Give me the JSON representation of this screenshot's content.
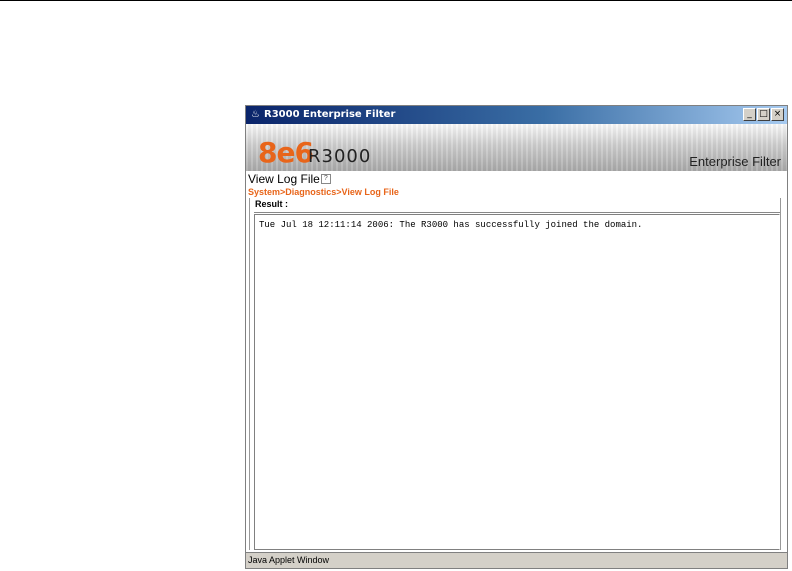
{
  "window": {
    "title": "R3000 Enterprise Filter",
    "controls": {
      "minimize": "_",
      "maximize": "□",
      "close": "×"
    },
    "icon": "java-icon"
  },
  "banner": {
    "brand": "8e6",
    "model": "R3000",
    "product": "Enterprise Filter",
    "brand_color": "#e8651a"
  },
  "page": {
    "title": "View Log File",
    "help_icon": "?",
    "breadcrumb": "System>Diagnostics>View Log File"
  },
  "result": {
    "label": "Result :",
    "log_lines": [
      "Tue Jul 18 12:11:14 2006: The R3000 has successfully joined the domain."
    ]
  },
  "status": {
    "text": "Java Applet Window"
  }
}
